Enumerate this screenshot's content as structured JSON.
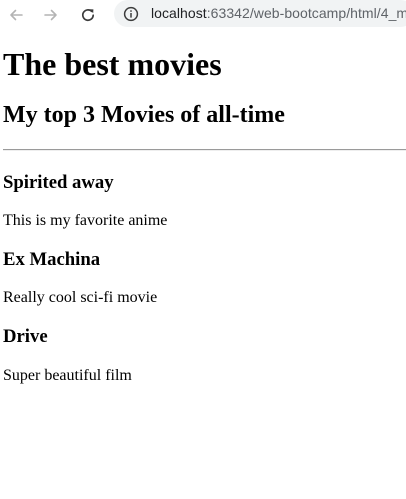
{
  "browser": {
    "url_host": "localhost",
    "url_path": ":63342/web-bootcamp/html/4_m",
    "back_icon": "arrow-left-icon",
    "forward_icon": "arrow-right-icon",
    "reload_icon": "reload-icon",
    "site_info_icon": "info-icon"
  },
  "page": {
    "title": "The best movies",
    "subtitle": "My top 3 Movies of all-time",
    "movies": [
      {
        "title": "Spirited away",
        "description": "This is my favorite anime"
      },
      {
        "title": "Ex Machina",
        "description": "Really cool sci-fi movie"
      },
      {
        "title": "Drive",
        "description": "Super beautiful film"
      }
    ]
  }
}
